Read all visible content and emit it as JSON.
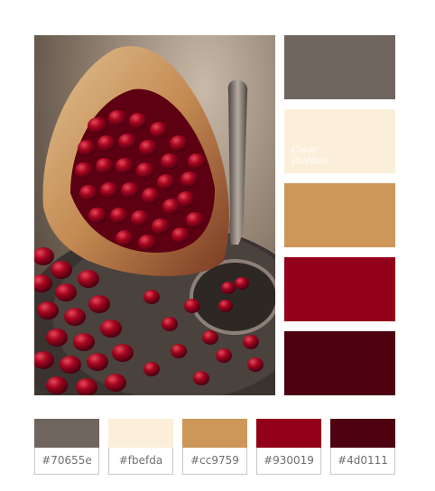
{
  "watermark": {
    "line1": "Color",
    "line2": "Palettes"
  },
  "palette": [
    {
      "code": "#70655e",
      "color": "#70655e"
    },
    {
      "code": "#fbefda",
      "color": "#fbefda"
    },
    {
      "code": "#cc9759",
      "color": "#cc9759"
    },
    {
      "code": "#930019",
      "color": "#930019"
    },
    {
      "code": "#4d0111",
      "color": "#4d0111"
    }
  ],
  "colors": {
    "swatch_1": "#70655e",
    "swatch_2": "#fbefda",
    "swatch_3": "#cc9759",
    "swatch_4": "#930019",
    "swatch_5": "#4d0111"
  }
}
